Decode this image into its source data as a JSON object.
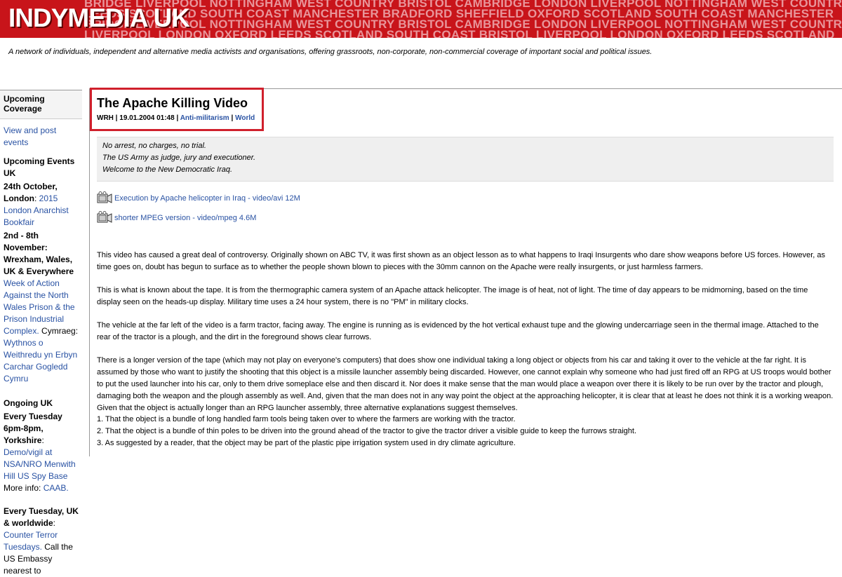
{
  "header": {
    "logo": "INDYMEDIA UK",
    "banner_lines": [
      "BRIDGE LIVERPOOL NOTTINGHAM WEST COUNTRY BRISTOL CAMBRIDGE LONDON LIVERPOOL NOTTINGHAM WEST COUNTRY",
      "LEEDS SCOTLAND SOUTH COAST MANCHESTER BRADFORD SHEFFIELD OXFORD SCOTLAND SOUTH COAST MANCHESTER",
      "BRIDGE LIVERPOOL NOTTINGHAM WEST COUNTRY BRISTOL CAMBRIDGE LONDON LIVERPOOL NOTTINGHAM WEST COUNTRY",
      "LIVERPOOL LONDON OXFORD LEEDS SCOTLAND SOUTH COAST BRISTOL LIVERPOOL LONDON OXFORD LEEDS SCOTLAND"
    ],
    "tagline": "A network of individuals, independent and alternative media activists and organisations, offering grassroots, non-corporate, non-commercial coverage of important social and political issues."
  },
  "sidebar": {
    "heading": "Upcoming Coverage",
    "view_link": "View and post events",
    "events_heading": "Upcoming Events UK",
    "event1_date": "24th October, London",
    "event1_link": "2015 London Anarchist Bookfair",
    "event2_date": "2nd - 8th November: Wrexham, Wales, UK & Everywhere",
    "event2_link": "Week of Action Against the North Wales Prison & the Prison Industrial Complex.",
    "event2_extra": "Cymraeg:",
    "event2_link2": "Wythnos o Weithredu yn Erbyn Carchar Gogledd Cymru",
    "ongoing_heading": "Ongoing UK",
    "ongoing1_date": "Every Tuesday 6pm-8pm, Yorkshire",
    "ongoing1_link": "Demo/vigil at NSA/NRO Menwith Hill US Spy Base",
    "ongoing1_more": "More info:",
    "ongoing1_link2": "CAAB.",
    "ongoing2_date": "Every Tuesday, UK & worldwide",
    "ongoing2_link": "Counter Terror Tuesdays.",
    "ongoing2_text": "Call the US Embassy nearest to"
  },
  "article": {
    "title": "The Apache Killing Video",
    "author": "WRH",
    "date": "19.01.2004 01:48",
    "sep": "|",
    "topic1": "Anti-militarism",
    "topic2": "World",
    "summary": [
      "No arrest, no charges, no trial.",
      "The US Army as judge, jury and executioner.",
      "Welcome to the New Democratic Iraq."
    ],
    "media": [
      {
        "label": "Execution by Apache helicopter in Iraq - video/avi 12M"
      },
      {
        "label": "shorter MPEG version - video/mpeg 4.6M"
      }
    ],
    "paragraphs": [
      "This video has caused a great deal of controversy. Originally shown on ABC TV, it was first shown as an object lesson as to what happens to Iraqi Insurgents who dare show weapons before US forces. However, as time goes on, doubt has begun to surface as to whether the people shown blown to pieces with the 30mm cannon on the Apache were really insurgents, or just harmless farmers.",
      "This is what is known about the tape. It is from the thermographic camera system of an Apache attack helicopter. The image is of heat, not of light. The time of day appears to be midmorning, based on the time display seen on the heads-up display. Military time uses a 24 hour system, there is no \"PM\" in military clocks.",
      "The vehicle at the far left of the video is a farm tractor, facing away. The engine is running as is evidenced by the hot vertical exhaust tupe and the glowing undercarriage seen in the thermal image. Attached to the rear of the tractor is a plough, and the dirt in the foreground shows clear furrows.",
      "There is a longer version of the tape (which may not play on everyone's computers) that does show one individual taking a long object or objects from his car and taking it over to the vehicle at the far right. It is assumed by those who want to justify the shooting that this object is a missile launcher assembly being discarded. However, one cannot explain why someone who had just fired off an RPG at US troops would bother to put the used launcher into his car, only to them drive someplace else and then discard it. Nor does it make sense that the man would place a weapon over there it is likely to be run over by the tractor and plough, damaging both the weapon and the plough assembly as well. And, given that the man does not in any way point the object at the approaching helicopter, it is clear that at least he does not think it is a working weapon. Given that the object is actually longer than an RPG launcher assembly, three alternative explanations suggest themselves."
    ],
    "list": [
      "1. That the object is a bundle of long handled farm tools being taken over to where the farmers are working with the tractor.",
      "2. That the object is a bundle of thin poles to be driven into the ground ahead of the tractor to give the tractor driver a visible guide to keep the furrows straight.",
      "3. As suggested by a reader, that the object may be part of the plastic pipe irrigation system used in dry climate agriculture."
    ]
  }
}
